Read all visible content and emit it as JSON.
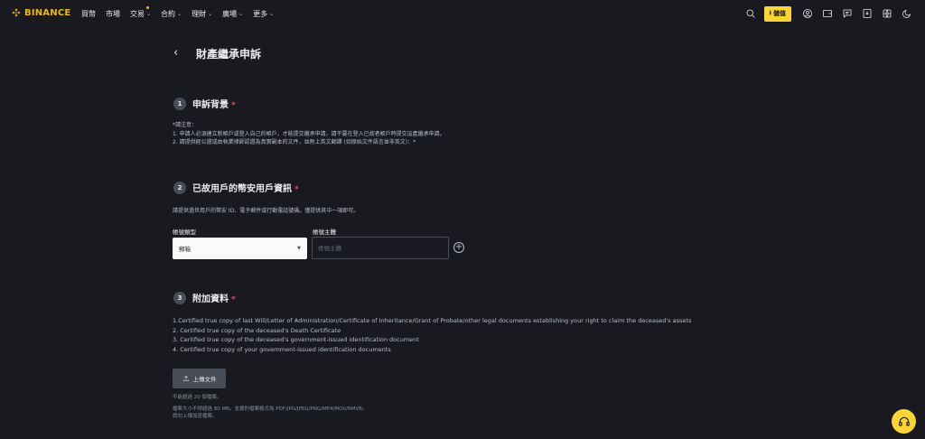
{
  "brand": {
    "name": "BINANCE",
    "accent": "#f0b90b"
  },
  "nav": {
    "items": [
      {
        "label": "買幣",
        "has_menu": false
      },
      {
        "label": "市場",
        "has_menu": false
      },
      {
        "label": "交易",
        "has_menu": true,
        "badge_dot": true
      },
      {
        "label": "合約",
        "has_menu": true
      },
      {
        "label": "理財",
        "has_menu": true
      },
      {
        "label": "廣場",
        "has_menu": true
      },
      {
        "label": "更多",
        "has_menu": true
      }
    ],
    "deposit_label": "儲值",
    "icons": [
      "search-icon",
      "download-icon",
      "user-icon",
      "wallet-icon",
      "message-icon",
      "app-download-icon",
      "globe-icon",
      "moon-icon"
    ]
  },
  "page": {
    "title": "財產繼承申訴"
  },
  "section1": {
    "number": "1",
    "title": "申訴背景",
    "required_mark": "*",
    "notes": [
      "*請注意：",
      "1. 申請人必須建立新帳戶或登入自己的帳戶，才能提交繼承申請。請不要在登入已故者帳戶時提交這產繼承申請。",
      "2. 請提供經公證或由執業律師認證為真實副本的文件，並附上英文翻譯 (如原始文件語言並非英文)：*"
    ]
  },
  "section2": {
    "number": "2",
    "title": "已故用戶的幣安用戶資訊",
    "required_mark": "*",
    "hint": "請提供過世用戶的幣安 ID、電子郵件或行動電話號碼。僅提供其中一項即可。",
    "account_type_label": "帳號類型",
    "account_type_value": "郵箱",
    "account_subject_label": "帳號主體",
    "account_subject_placeholder": "帳號主體"
  },
  "section3": {
    "number": "3",
    "title": "附加資料",
    "required_mark": "*",
    "documents": [
      "1.Certified true copy of last Will/Letter of Administration/Certificate of Inheritance/Grant of Probate/other legal documents establishing your right to claim the deceased's assets",
      "2. Certified true copy of the deceased's Death Certificate",
      "3. Certified true copy of the deceased's government-issued identification document",
      "4. Certified true copy of your government-issued identification documents"
    ],
    "upload_label": "上傳文件",
    "upload_notes": [
      "不能超過 20 個檔案。",
      "檔案大小不得超過 80 MB。支援的檔案格式為 PDF/JPG/JPEG/PNG/MP4/MOV/RMVB。",
      "請勿上傳加密檔案。"
    ]
  },
  "colors": {
    "background": "#181a20",
    "primary_yellow": "#fcd535",
    "required_red": "#f6465d",
    "muted_text": "#b7bdc6"
  }
}
